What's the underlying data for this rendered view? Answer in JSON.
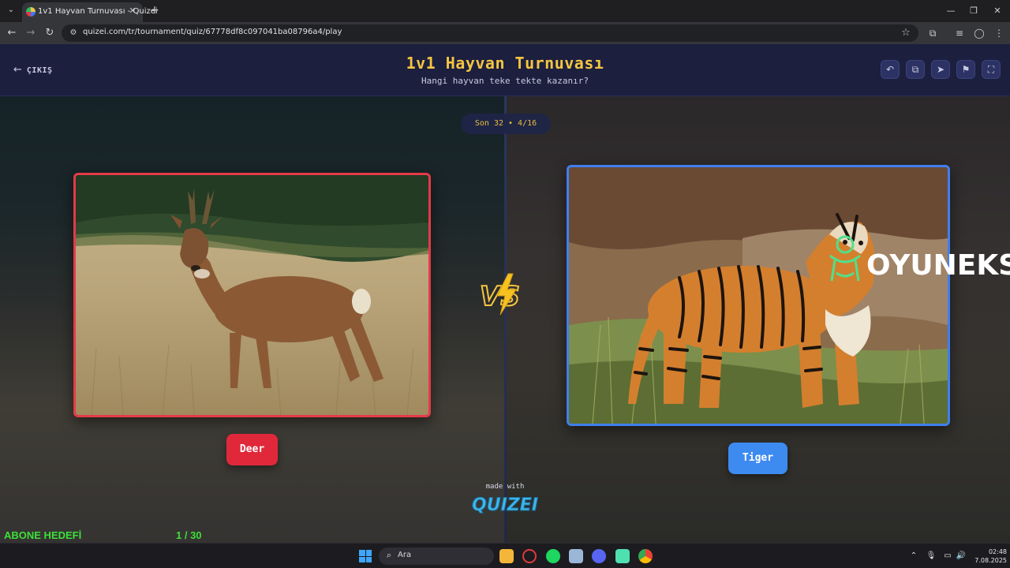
{
  "browser": {
    "tab_title": "1v1 Hayvan Turnuvası - Quizei",
    "url": "quizei.com/tr/tournament/quiz/67778df8c097041ba08796a4/play"
  },
  "header": {
    "exit_label": "ÇIKIŞ",
    "title": "1v1 Hayvan Turnuvası",
    "subtitle": "Hangi hayvan teke tekte kazanır?"
  },
  "round": {
    "label": "Son 32 • 4/16"
  },
  "matchup": {
    "left": {
      "label": "Deer",
      "color": "#e1283b"
    },
    "right": {
      "label": "Tiger",
      "color": "#3d8bf0"
    }
  },
  "watermark": {
    "text": "OYUNEKS"
  },
  "footer": {
    "made_with": "made with",
    "brand": "QUIZEI"
  },
  "stream_overlay": {
    "goal_label": "ABONE HEDEFİ",
    "goal_count": "1  / 30",
    "goal_progress": 0.0333
  },
  "taskbar": {
    "search_placeholder": "Ara",
    "time": "02:48",
    "date": "7.08.2025"
  }
}
